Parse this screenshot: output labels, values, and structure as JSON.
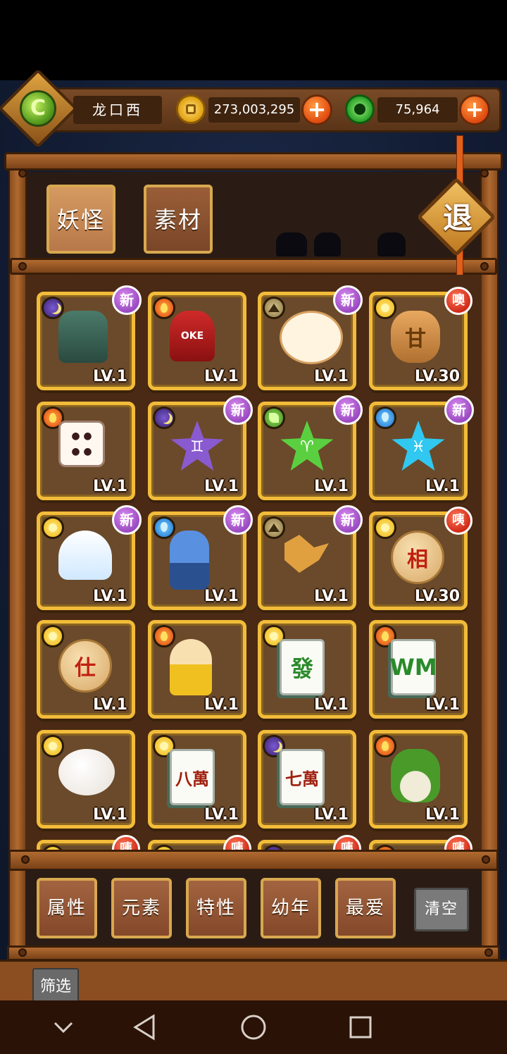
{
  "player": {
    "name": "龙口西",
    "avatar_icon": "dragon-emblem-icon",
    "avatar_glyph": "C"
  },
  "resources": {
    "gold": {
      "value": "273,003,295",
      "icon": "gold-coin-icon",
      "plus": "+"
    },
    "jade": {
      "value": "75,964",
      "icon": "jade-coin-icon",
      "plus": "+"
    }
  },
  "tabs": [
    {
      "label": "妖怪",
      "active": true
    },
    {
      "label": "素材",
      "active": false
    }
  ],
  "exit_label": "退",
  "cards": [
    {
      "element": "moon",
      "badge": "新",
      "badge_type": "new",
      "art": "totem",
      "glyph": "",
      "level": "LV.1"
    },
    {
      "element": "fire",
      "badge": "",
      "badge_type": "",
      "art": "bell",
      "glyph": "OKE",
      "level": "LV.1"
    },
    {
      "element": "earth",
      "badge": "新",
      "badge_type": "new",
      "art": "cow",
      "glyph": "",
      "level": "LV.1"
    },
    {
      "element": "sun",
      "badge": "噢",
      "badge_type": "tag",
      "art": "seal",
      "glyph": "甘",
      "level": "LV.30"
    },
    {
      "element": "fire",
      "badge": "",
      "badge_type": "",
      "art": "dice",
      "glyph": "",
      "level": "LV.1"
    },
    {
      "element": "moon",
      "badge": "新",
      "badge_type": "new",
      "art": "star-purple",
      "glyph": "♊",
      "level": "LV.1"
    },
    {
      "element": "leaf",
      "badge": "新",
      "badge_type": "new",
      "art": "star-green",
      "glyph": "♈",
      "level": "LV.1"
    },
    {
      "element": "water",
      "badge": "新",
      "badge_type": "new",
      "art": "star-blue",
      "glyph": "♓",
      "level": "LV.1"
    },
    {
      "element": "sun",
      "badge": "新",
      "badge_type": "new",
      "art": "ghost",
      "glyph": "",
      "level": "LV.1"
    },
    {
      "element": "water",
      "badge": "新",
      "badge_type": "new",
      "art": "knight",
      "glyph": "",
      "level": "LV.1"
    },
    {
      "element": "earth",
      "badge": "新",
      "badge_type": "new",
      "art": "leaf",
      "glyph": "",
      "level": "LV.1"
    },
    {
      "element": "sun",
      "badge": "咦",
      "badge_type": "tag",
      "art": "round",
      "glyph": "相",
      "level": "LV.30"
    },
    {
      "element": "sun",
      "badge": "",
      "badge_type": "",
      "art": "round",
      "glyph": "仕",
      "level": "LV.1"
    },
    {
      "element": "fire",
      "badge": "",
      "badge_type": "",
      "art": "doll",
      "glyph": "",
      "level": "LV.1"
    },
    {
      "element": "sun",
      "badge": "",
      "badge_type": "",
      "art": "tile",
      "glyph": "發",
      "level": "LV.1"
    },
    {
      "element": "fire",
      "badge": "",
      "badge_type": "",
      "art": "tile",
      "glyph": "WM",
      "level": "LV.1"
    },
    {
      "element": "sun",
      "badge": "",
      "badge_type": "",
      "art": "bun",
      "glyph": "",
      "level": "LV.1"
    },
    {
      "element": "sun",
      "badge": "",
      "badge_type": "",
      "art": "tile-red",
      "glyph": "八萬",
      "level": "LV.1"
    },
    {
      "element": "moon",
      "badge": "",
      "badge_type": "",
      "art": "tile-red",
      "glyph": "七萬",
      "level": "LV.1"
    },
    {
      "element": "fire",
      "badge": "",
      "badge_type": "",
      "art": "plant",
      "glyph": "",
      "level": "LV.1"
    },
    {
      "element": "sun",
      "badge": "咦",
      "badge_type": "tag",
      "art": "round",
      "glyph": "",
      "level": ""
    },
    {
      "element": "sun",
      "badge": "咦",
      "badge_type": "tag",
      "art": "round",
      "glyph": "",
      "level": ""
    },
    {
      "element": "moon",
      "badge": "咦",
      "badge_type": "tag",
      "art": "round",
      "glyph": "",
      "level": ""
    },
    {
      "element": "fire",
      "badge": "咦",
      "badge_type": "tag",
      "art": "round",
      "glyph": "",
      "level": ""
    }
  ],
  "filters": [
    "属性",
    "元素",
    "特性",
    "幼年",
    "最爱"
  ],
  "clear_label": "清空",
  "screen_label": "筛选",
  "nav": {
    "back_icon": "chevron-down-icon",
    "home_icon": "circle-home-icon",
    "triangle_icon": "triangle-back-icon",
    "recent_icon": "square-recents-icon"
  }
}
